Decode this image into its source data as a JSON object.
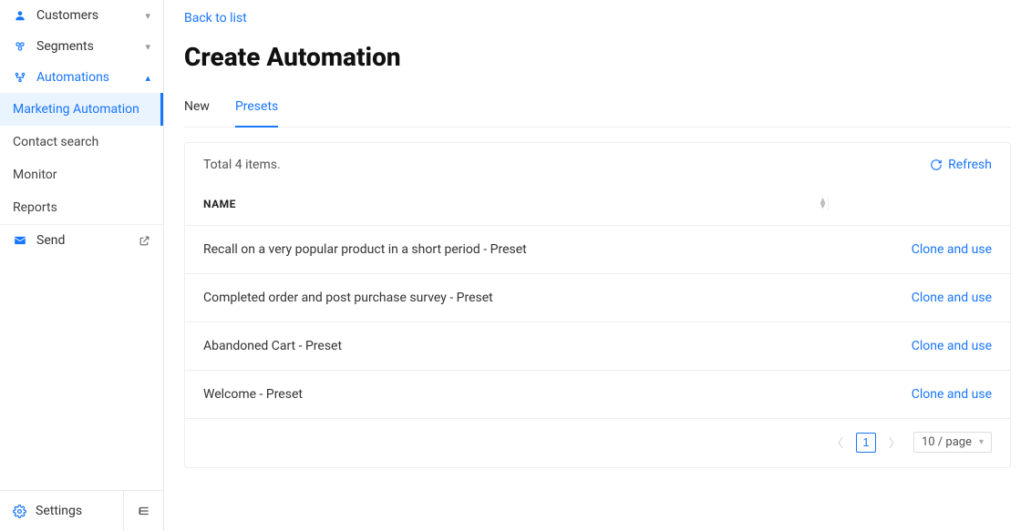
{
  "sidebar": {
    "items": [
      {
        "label": "Customers"
      },
      {
        "label": "Segments"
      },
      {
        "label": "Automations"
      },
      {
        "label": "Send"
      }
    ],
    "subitems": [
      {
        "label": "Marketing Automation"
      },
      {
        "label": "Contact search"
      },
      {
        "label": "Monitor"
      },
      {
        "label": "Reports"
      }
    ],
    "settings_label": "Settings"
  },
  "main": {
    "back_link": "Back to list",
    "title": "Create Automation",
    "tabs": [
      {
        "label": "New"
      },
      {
        "label": "Presets"
      }
    ],
    "total_text": "Total 4 items.",
    "refresh_label": "Refresh",
    "column_name": "NAME",
    "clone_label": "Clone and use",
    "rows": [
      {
        "name": "Recall on a very popular product in a short period - Preset"
      },
      {
        "name": "Completed order and post purchase survey - Preset"
      },
      {
        "name": "Abandoned Cart - Preset"
      },
      {
        "name": "Welcome - Preset"
      }
    ],
    "pagination": {
      "current": "1",
      "page_size_label": "10 / page"
    }
  }
}
